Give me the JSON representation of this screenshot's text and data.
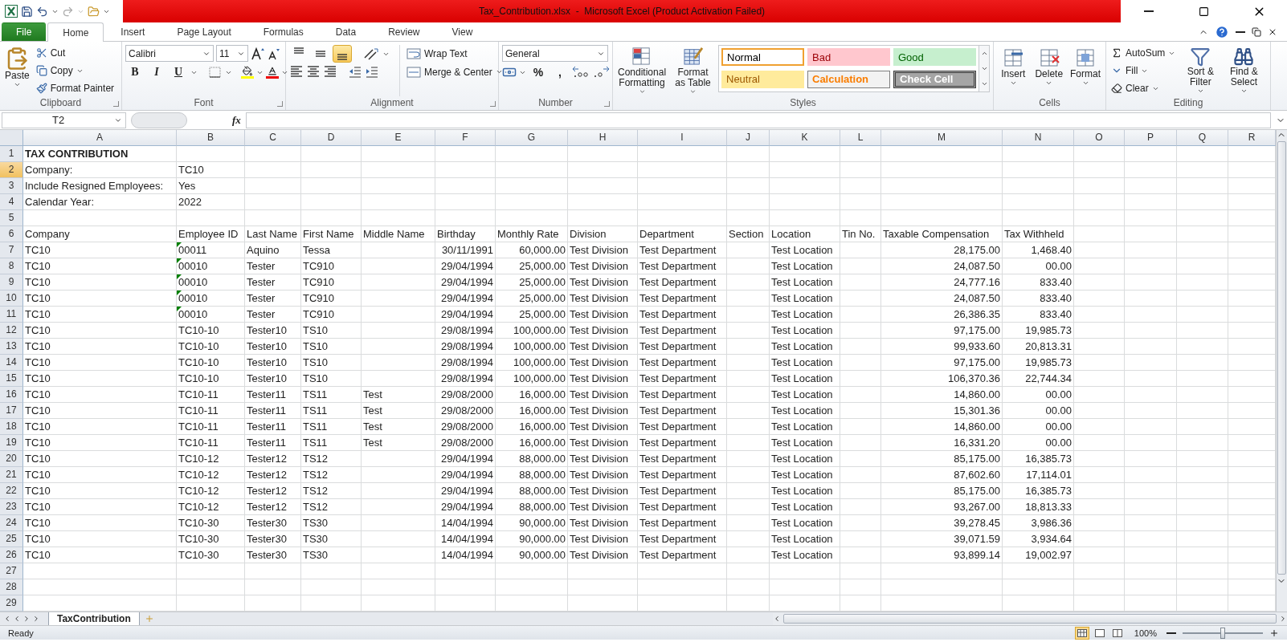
{
  "window": {
    "title": "Tax_Contribution.xlsx  -  Microsoft Excel (Product Activation Failed)"
  },
  "ribbon_tabs": [
    {
      "label": "File",
      "kind": "file",
      "selected": false
    },
    {
      "label": "Home",
      "kind": "tab",
      "selected": true
    },
    {
      "label": "Insert",
      "kind": "tab",
      "selected": false
    },
    {
      "label": "Page Layout",
      "kind": "tab",
      "selected": false
    },
    {
      "label": "Formulas",
      "kind": "tab",
      "selected": false
    },
    {
      "label": "Data",
      "kind": "tab",
      "selected": false
    },
    {
      "label": "Review",
      "kind": "tab",
      "selected": false
    },
    {
      "label": "View",
      "kind": "tab",
      "selected": false
    }
  ],
  "ribbon_groups": [
    {
      "kind": "clipboard",
      "label": "Clipboard",
      "paste": "Paste",
      "items": [
        "Cut",
        "Copy",
        "Format Painter"
      ]
    },
    {
      "kind": "font",
      "label": "Font",
      "font_name": "Calibri",
      "font_size": "11",
      "styles": [
        "B",
        "I",
        "U"
      ]
    },
    {
      "kind": "alignment",
      "label": "Alignment",
      "wrap": "Wrap Text",
      "merge": "Merge & Center",
      "vertical_buttons": [
        {
          "selected": false
        },
        {
          "selected": false
        },
        {
          "selected": true
        }
      ]
    },
    {
      "kind": "number",
      "label": "Number",
      "format": "General",
      "symbols": [
        "%",
        ","
      ]
    },
    {
      "kind": "styles",
      "label": "Styles",
      "conditional": "Conditional Formatting",
      "table": "Format as Table",
      "cell_styles": [
        {
          "label": "Normal",
          "kind": "normal",
          "selected": true
        },
        {
          "label": "Bad",
          "kind": "bad",
          "selected": false
        },
        {
          "label": "Good",
          "kind": "good",
          "selected": false
        },
        {
          "label": "Neutral",
          "kind": "neutral",
          "selected": false
        },
        {
          "label": "Calculation",
          "kind": "calculation",
          "selected": false
        },
        {
          "label": "Check Cell",
          "kind": "check",
          "selected": false
        }
      ]
    },
    {
      "kind": "cells",
      "label": "Cells",
      "buttons": [
        "Insert",
        "Delete",
        "Format"
      ]
    },
    {
      "kind": "editing",
      "label": "Editing",
      "items": [
        "AutoSum",
        "Fill",
        "Clear"
      ],
      "large": [
        "Sort & Filter",
        "Find & Select"
      ]
    }
  ],
  "formula_bar": {
    "name_box": "T2",
    "function_label": "fx"
  },
  "sheet": {
    "columns": [
      {
        "label": "A",
        "kind": "text"
      },
      {
        "label": "B",
        "kind": "text"
      },
      {
        "label": "C",
        "kind": "text"
      },
      {
        "label": "D",
        "kind": "text"
      },
      {
        "label": "E",
        "kind": "text"
      },
      {
        "label": "F",
        "kind": "number"
      },
      {
        "label": "G",
        "kind": "number"
      },
      {
        "label": "H",
        "kind": "text"
      },
      {
        "label": "I",
        "kind": "text"
      },
      {
        "label": "J",
        "kind": "text"
      },
      {
        "label": "K",
        "kind": "text"
      },
      {
        "label": "L",
        "kind": "text"
      },
      {
        "label": "M",
        "kind": "number"
      },
      {
        "label": "N",
        "kind": "number"
      },
      {
        "label": "O",
        "kind": "text"
      },
      {
        "label": "P",
        "kind": "text"
      },
      {
        "label": "Q",
        "kind": "text"
      },
      {
        "label": "R",
        "kind": "text"
      }
    ],
    "rows": [
      {
        "number": "1",
        "kind": "title",
        "selected": false,
        "flag": false,
        "cells": [
          "TAX CONTRIBUTION"
        ]
      },
      {
        "number": "2",
        "kind": "info",
        "selected": true,
        "flag": false,
        "cells": [
          "Company:",
          "TC10"
        ]
      },
      {
        "number": "3",
        "kind": "info",
        "selected": false,
        "flag": false,
        "cells": [
          "Include Resigned Employees:",
          "Yes"
        ]
      },
      {
        "number": "4",
        "kind": "info",
        "selected": false,
        "flag": false,
        "cells": [
          "Calendar Year:",
          "2022"
        ]
      },
      {
        "number": "5",
        "kind": "info",
        "selected": false,
        "flag": false
      },
      {
        "number": "6",
        "kind": "header",
        "selected": false,
        "flag": false,
        "cells": [
          "Company",
          "Employee ID",
          "Last Name",
          "First Name",
          "Middle Name",
          "Birthday",
          "Monthly Rate",
          "Division",
          "Department",
          "Section",
          "Location",
          "Tin No.",
          "Taxable Compensation",
          "Tax Withheld"
        ]
      },
      {
        "number": "7",
        "kind": "data",
        "selected": false,
        "flag": true,
        "cells": [
          "TC10",
          "00011",
          "Aquino",
          "Tessa",
          null,
          "30/11/1991",
          "60,000.00",
          "Test Division",
          "Test Department",
          null,
          "Test Location",
          null,
          "28,175.00",
          "1,468.40"
        ]
      },
      {
        "number": "8",
        "kind": "data",
        "selected": false,
        "flag": true,
        "cells": [
          "TC10",
          "00010",
          "Tester",
          "TC910",
          null,
          "29/04/1994",
          "25,000.00",
          "Test Division",
          "Test Department",
          null,
          "Test Location",
          null,
          "24,087.50",
          "00.00"
        ]
      },
      {
        "number": "9",
        "kind": "data",
        "selected": false,
        "flag": true,
        "cells": [
          "TC10",
          "00010",
          "Tester",
          "TC910",
          null,
          "29/04/1994",
          "25,000.00",
          "Test Division",
          "Test Department",
          null,
          "Test Location",
          null,
          "24,777.16",
          "833.40"
        ]
      },
      {
        "number": "10",
        "kind": "data",
        "selected": false,
        "flag": true,
        "cells": [
          "TC10",
          "00010",
          "Tester",
          "TC910",
          null,
          "29/04/1994",
          "25,000.00",
          "Test Division",
          "Test Department",
          null,
          "Test Location",
          null,
          "24,087.50",
          "833.40"
        ]
      },
      {
        "number": "11",
        "kind": "data",
        "selected": false,
        "flag": true,
        "cells": [
          "TC10",
          "00010",
          "Tester",
          "TC910",
          null,
          "29/04/1994",
          "25,000.00",
          "Test Division",
          "Test Department",
          null,
          "Test Location",
          null,
          "26,386.35",
          "833.40"
        ]
      },
      {
        "number": "12",
        "kind": "data",
        "selected": false,
        "flag": false,
        "cells": [
          "TC10",
          "TC10-10",
          "Tester10",
          "TS10",
          null,
          "29/08/1994",
          "100,000.00",
          "Test Division",
          "Test Department",
          null,
          "Test Location",
          null,
          "97,175.00",
          "19,985.73"
        ]
      },
      {
        "number": "13",
        "kind": "data",
        "selected": false,
        "flag": false,
        "cells": [
          "TC10",
          "TC10-10",
          "Tester10",
          "TS10",
          null,
          "29/08/1994",
          "100,000.00",
          "Test Division",
          "Test Department",
          null,
          "Test Location",
          null,
          "99,933.60",
          "20,813.31"
        ]
      },
      {
        "number": "14",
        "kind": "data",
        "selected": false,
        "flag": false,
        "cells": [
          "TC10",
          "TC10-10",
          "Tester10",
          "TS10",
          null,
          "29/08/1994",
          "100,000.00",
          "Test Division",
          "Test Department",
          null,
          "Test Location",
          null,
          "97,175.00",
          "19,985.73"
        ]
      },
      {
        "number": "15",
        "kind": "data",
        "selected": false,
        "flag": false,
        "cells": [
          "TC10",
          "TC10-10",
          "Tester10",
          "TS10",
          null,
          "29/08/1994",
          "100,000.00",
          "Test Division",
          "Test Department",
          null,
          "Test Location",
          null,
          "106,370.36",
          "22,744.34"
        ]
      },
      {
        "number": "16",
        "kind": "data",
        "selected": false,
        "flag": false,
        "cells": [
          "TC10",
          "TC10-11",
          "Tester11",
          "TS11",
          "Test",
          "29/08/2000",
          "16,000.00",
          "Test Division",
          "Test Department",
          null,
          "Test Location",
          null,
          "14,860.00",
          "00.00"
        ]
      },
      {
        "number": "17",
        "kind": "data",
        "selected": false,
        "flag": false,
        "cells": [
          "TC10",
          "TC10-11",
          "Tester11",
          "TS11",
          "Test",
          "29/08/2000",
          "16,000.00",
          "Test Division",
          "Test Department",
          null,
          "Test Location",
          null,
          "15,301.36",
          "00.00"
        ]
      },
      {
        "number": "18",
        "kind": "data",
        "selected": false,
        "flag": false,
        "cells": [
          "TC10",
          "TC10-11",
          "Tester11",
          "TS11",
          "Test",
          "29/08/2000",
          "16,000.00",
          "Test Division",
          "Test Department",
          null,
          "Test Location",
          null,
          "14,860.00",
          "00.00"
        ]
      },
      {
        "number": "19",
        "kind": "data",
        "selected": false,
        "flag": false,
        "cells": [
          "TC10",
          "TC10-11",
          "Tester11",
          "TS11",
          "Test",
          "29/08/2000",
          "16,000.00",
          "Test Division",
          "Test Department",
          null,
          "Test Location",
          null,
          "16,331.20",
          "00.00"
        ]
      },
      {
        "number": "20",
        "kind": "data",
        "selected": false,
        "flag": false,
        "cells": [
          "TC10",
          "TC10-12",
          "Tester12",
          "TS12",
          null,
          "29/04/1994",
          "88,000.00",
          "Test Division",
          "Test Department",
          null,
          "Test Location",
          null,
          "85,175.00",
          "16,385.73"
        ]
      },
      {
        "number": "21",
        "kind": "data",
        "selected": false,
        "flag": false,
        "cells": [
          "TC10",
          "TC10-12",
          "Tester12",
          "TS12",
          null,
          "29/04/1994",
          "88,000.00",
          "Test Division",
          "Test Department",
          null,
          "Test Location",
          null,
          "87,602.60",
          "17,114.01"
        ]
      },
      {
        "number": "22",
        "kind": "data",
        "selected": false,
        "flag": false,
        "cells": [
          "TC10",
          "TC10-12",
          "Tester12",
          "TS12",
          null,
          "29/04/1994",
          "88,000.00",
          "Test Division",
          "Test Department",
          null,
          "Test Location",
          null,
          "85,175.00",
          "16,385.73"
        ]
      },
      {
        "number": "23",
        "kind": "data",
        "selected": false,
        "flag": false,
        "cells": [
          "TC10",
          "TC10-12",
          "Tester12",
          "TS12",
          null,
          "29/04/1994",
          "88,000.00",
          "Test Division",
          "Test Department",
          null,
          "Test Location",
          null,
          "93,267.00",
          "18,813.33"
        ]
      },
      {
        "number": "24",
        "kind": "data",
        "selected": false,
        "flag": false,
        "cells": [
          "TC10",
          "TC10-30",
          "Tester30",
          "TS30",
          null,
          "14/04/1994",
          "90,000.00",
          "Test Division",
          "Test Department",
          null,
          "Test Location",
          null,
          "39,278.45",
          "3,986.36"
        ]
      },
      {
        "number": "25",
        "kind": "data",
        "selected": false,
        "flag": false,
        "cells": [
          "TC10",
          "TC10-30",
          "Tester30",
          "TS30",
          null,
          "14/04/1994",
          "90,000.00",
          "Test Division",
          "Test Department",
          null,
          "Test Location",
          null,
          "39,071.59",
          "3,934.64"
        ]
      },
      {
        "number": "26",
        "kind": "data",
        "selected": false,
        "flag": false,
        "cells": [
          "TC10",
          "TC10-30",
          "Tester30",
          "TS30",
          null,
          "14/04/1994",
          "90,000.00",
          "Test Division",
          "Test Department",
          null,
          "Test Location",
          null,
          "93,899.14",
          "19,002.97"
        ]
      },
      {
        "number": "27",
        "kind": "data",
        "selected": false,
        "flag": false
      },
      {
        "number": "28",
        "kind": "data",
        "selected": false,
        "flag": false
      },
      {
        "number": "29",
        "kind": "data",
        "selected": false,
        "flag": false
      }
    ]
  },
  "sheet_tabs": [
    {
      "label": "TaxContribution",
      "selected": true
    }
  ],
  "status_bar": {
    "status": "Ready",
    "views": [
      {
        "selected": true
      },
      {
        "selected": false
      },
      {
        "selected": false
      }
    ],
    "zoom": "100%",
    "zoom_slider": {
      "level": 0.5
    }
  }
}
